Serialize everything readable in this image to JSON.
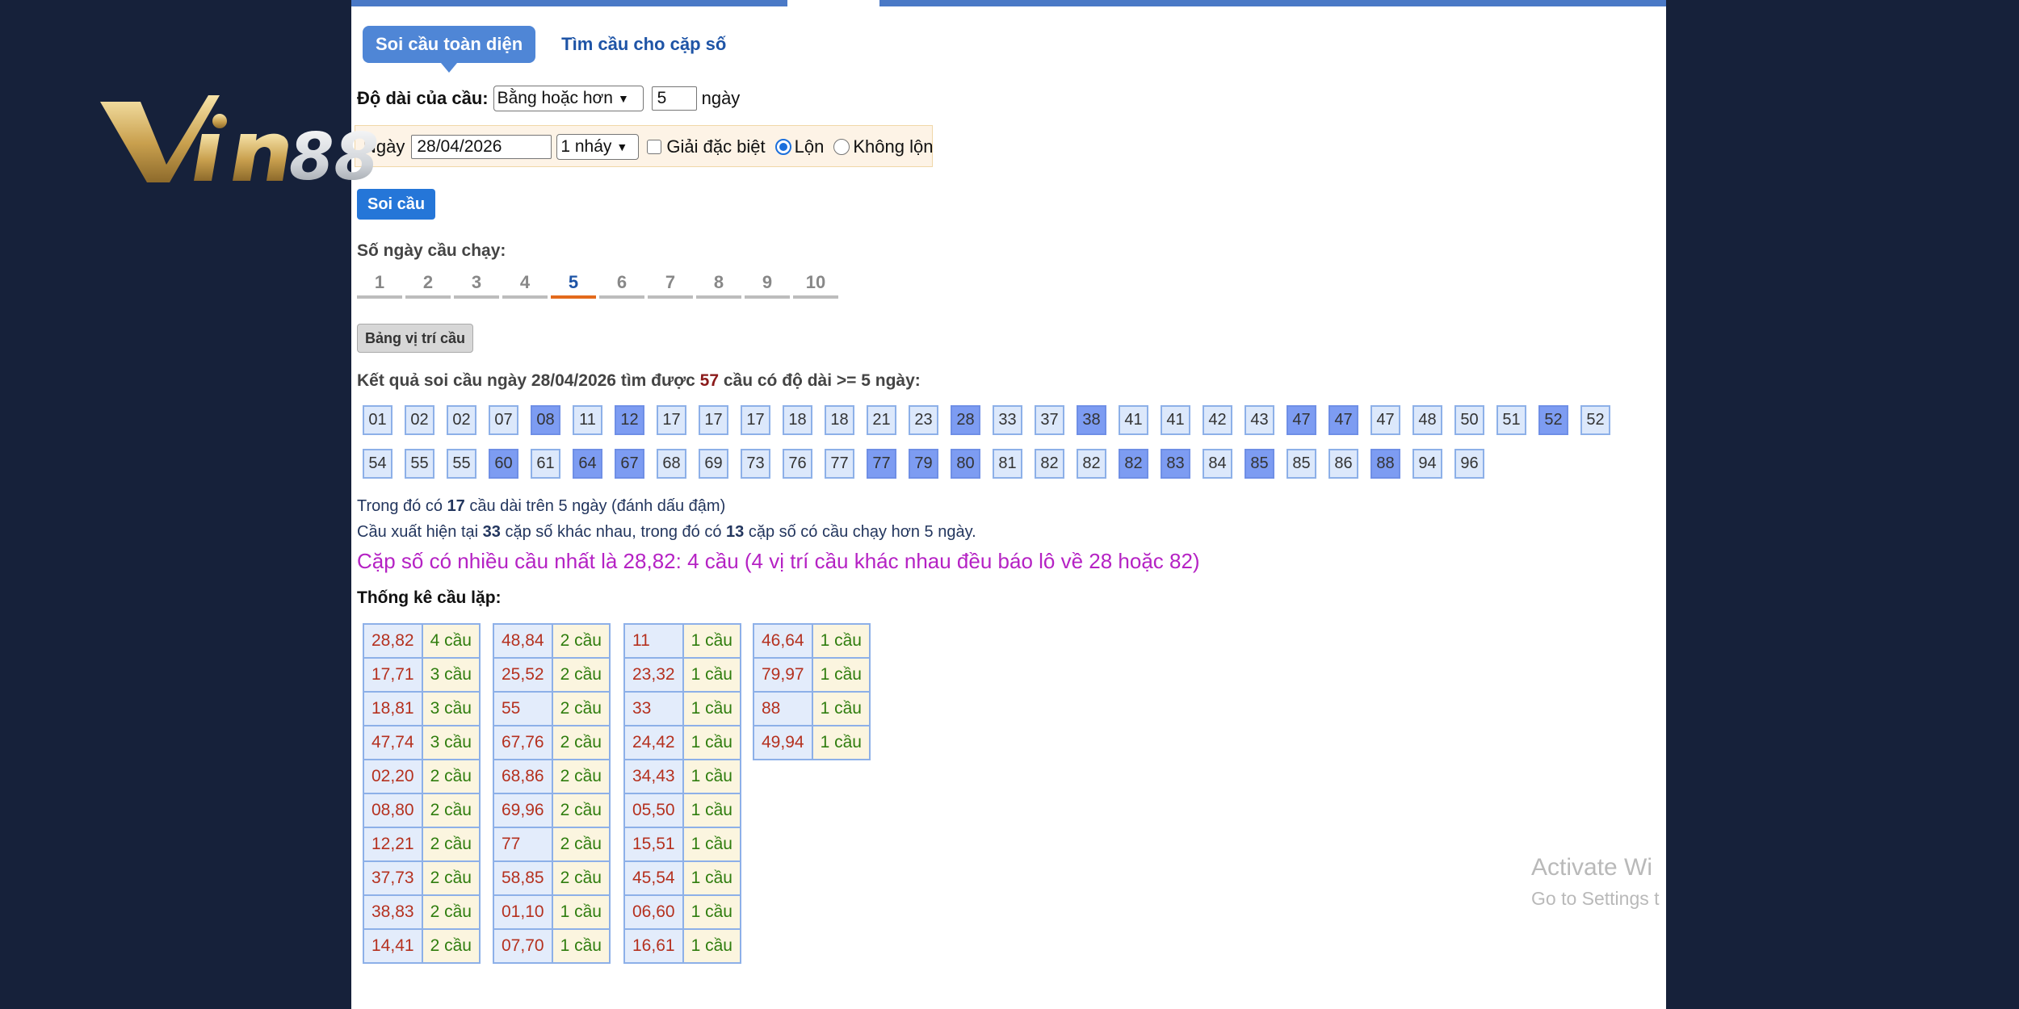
{
  "tabs": {
    "active": "Soi cầu toàn diện",
    "other": "Tìm cầu cho cặp số"
  },
  "length_row": {
    "label": "Độ dài của cầu:",
    "select_value": "Bằng hoặc hơn",
    "days_value": "5",
    "days_unit": "ngày"
  },
  "date_row": {
    "label": "Ngày",
    "date_value": "28/04/2026",
    "nhay_value": "1 nháy",
    "checkbox_label": "Giải đặc biệt",
    "radio_lon": "Lộn",
    "radio_khong_lon": "Không lộn"
  },
  "buttons": {
    "soi_cau": "Soi cầu",
    "bang_vi_tri": "Bảng vị trí cầu"
  },
  "days": {
    "label": "Số ngày cầu chạy:",
    "items": [
      "1",
      "2",
      "3",
      "4",
      "5",
      "6",
      "7",
      "8",
      "9",
      "10"
    ],
    "active": "5"
  },
  "result": {
    "prefix": "Kết quả soi cầu ngày 28/04/2026 tìm được",
    "count": "57",
    "suffix": "cầu có độ dài >= 5 ngày:"
  },
  "numbers": [
    {
      "v": "01",
      "hi": false
    },
    {
      "v": "02",
      "hi": false
    },
    {
      "v": "02",
      "hi": false
    },
    {
      "v": "07",
      "hi": false
    },
    {
      "v": "08",
      "hi": true
    },
    {
      "v": "11",
      "hi": false
    },
    {
      "v": "12",
      "hi": true
    },
    {
      "v": "17",
      "hi": false
    },
    {
      "v": "17",
      "hi": false
    },
    {
      "v": "17",
      "hi": false
    },
    {
      "v": "18",
      "hi": false
    },
    {
      "v": "18",
      "hi": false
    },
    {
      "v": "21",
      "hi": false
    },
    {
      "v": "23",
      "hi": false
    },
    {
      "v": "28",
      "hi": true
    },
    {
      "v": "33",
      "hi": false
    },
    {
      "v": "37",
      "hi": false
    },
    {
      "v": "38",
      "hi": true
    },
    {
      "v": "41",
      "hi": false
    },
    {
      "v": "41",
      "hi": false
    },
    {
      "v": "42",
      "hi": false
    },
    {
      "v": "43",
      "hi": false
    },
    {
      "v": "47",
      "hi": true
    },
    {
      "v": "47",
      "hi": true
    },
    {
      "v": "47",
      "hi": false
    },
    {
      "v": "48",
      "hi": false
    },
    {
      "v": "50",
      "hi": false
    },
    {
      "v": "51",
      "hi": false
    },
    {
      "v": "52",
      "hi": true
    },
    {
      "v": "52",
      "hi": false
    },
    {
      "v": "54",
      "hi": false
    },
    {
      "v": "55",
      "hi": false
    },
    {
      "v": "55",
      "hi": false
    },
    {
      "v": "60",
      "hi": true
    },
    {
      "v": "61",
      "hi": false
    },
    {
      "v": "64",
      "hi": true
    },
    {
      "v": "67",
      "hi": true
    },
    {
      "v": "68",
      "hi": false
    },
    {
      "v": "69",
      "hi": false
    },
    {
      "v": "73",
      "hi": false
    },
    {
      "v": "76",
      "hi": false
    },
    {
      "v": "77",
      "hi": false
    },
    {
      "v": "77",
      "hi": true
    },
    {
      "v": "79",
      "hi": true
    },
    {
      "v": "80",
      "hi": true
    },
    {
      "v": "81",
      "hi": false
    },
    {
      "v": "82",
      "hi": false
    },
    {
      "v": "82",
      "hi": false
    },
    {
      "v": "82",
      "hi": true
    },
    {
      "v": "83",
      "hi": true
    },
    {
      "v": "84",
      "hi": false
    },
    {
      "v": "85",
      "hi": true
    },
    {
      "v": "85",
      "hi": false
    },
    {
      "v": "86",
      "hi": false
    },
    {
      "v": "88",
      "hi": true
    },
    {
      "v": "94",
      "hi": false
    },
    {
      "v": "96",
      "hi": false
    }
  ],
  "info1": {
    "a": "Trong đó có",
    "b": "17",
    "c": "cầu dài trên 5 ngày (đánh dấu đậm)"
  },
  "info2": {
    "a": "Cầu xuất hiện tại",
    "b": "33",
    "c": "cặp số khác nhau, trong đó có",
    "d": "13",
    "e": "cặp số có cầu chạy hơn 5 ngày."
  },
  "most": "Cặp số có nhiều cầu nhất là 28,82: 4 cầu (4 vị trí cầu khác nhau đều báo lô về 28 hoặc 82)",
  "stats_title": "Thống kê cầu lặp:",
  "stats": [
    [
      [
        "28,82",
        "4 cầu"
      ],
      [
        "17,71",
        "3 cầu"
      ],
      [
        "18,81",
        "3 cầu"
      ],
      [
        "47,74",
        "3 cầu"
      ],
      [
        "02,20",
        "2 cầu"
      ],
      [
        "08,80",
        "2 cầu"
      ],
      [
        "12,21",
        "2 cầu"
      ],
      [
        "37,73",
        "2 cầu"
      ],
      [
        "38,83",
        "2 cầu"
      ],
      [
        "14,41",
        "2 cầu"
      ]
    ],
    [
      [
        "48,84",
        "2 cầu"
      ],
      [
        "25,52",
        "2 cầu"
      ],
      [
        "55",
        "2 cầu"
      ],
      [
        "67,76",
        "2 cầu"
      ],
      [
        "68,86",
        "2 cầu"
      ],
      [
        "69,96",
        "2 cầu"
      ],
      [
        "77",
        "2 cầu"
      ],
      [
        "58,85",
        "2 cầu"
      ],
      [
        "01,10",
        "1 cầu"
      ],
      [
        "07,70",
        "1 cầu"
      ]
    ],
    [
      [
        "11",
        "1 cầu"
      ],
      [
        "23,32",
        "1 cầu"
      ],
      [
        "33",
        "1 cầu"
      ],
      [
        "24,42",
        "1 cầu"
      ],
      [
        "34,43",
        "1 cầu"
      ],
      [
        "05,50",
        "1 cầu"
      ],
      [
        "15,51",
        "1 cầu"
      ],
      [
        "45,54",
        "1 cầu"
      ],
      [
        "06,60",
        "1 cầu"
      ],
      [
        "16,61",
        "1 cầu"
      ]
    ],
    [
      [
        "46,64",
        "1 cầu"
      ],
      [
        "79,97",
        "1 cầu"
      ],
      [
        "88",
        "1 cầu"
      ],
      [
        "49,94",
        "1 cầu"
      ]
    ]
  ],
  "watermark": {
    "line1": "Activate Wi",
    "line2": "Go to Settings t"
  },
  "logo": {
    "text": "Vin88"
  },
  "colors": {
    "accent": "#4f86d6",
    "button": "#2576d8",
    "highlight": "#7d9cf2",
    "pair": "#b5311f",
    "count": "#2f7d0e",
    "most": "#b522c4"
  }
}
